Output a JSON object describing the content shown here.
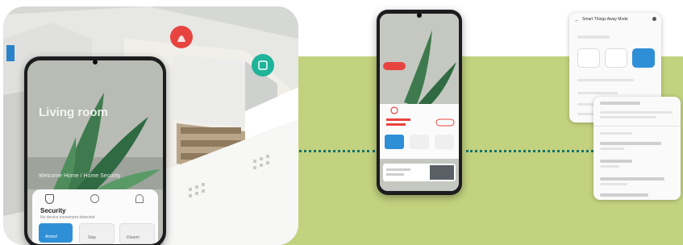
{
  "app": {
    "mode_label": "Smart Things Away Mode"
  },
  "main_phone": {
    "room_title": "Living room",
    "scene_caption": "Welcome Home / Home Security",
    "card_title": "Security",
    "card_subtitle": "No device movement detected",
    "buttons": [
      "Armed",
      "Stay",
      "Disarm"
    ]
  },
  "colors": {
    "green_band": "#c3d27f",
    "connector": "#16736a",
    "pin_alert": "#e8443f",
    "pin_ok": "#1fb39a",
    "accent": "#2f8fd6"
  },
  "icons": [
    "fire-alert-pin",
    "shield-ok-pin",
    "shield-icon",
    "gear-icon",
    "bell-icon",
    "more-icon"
  ]
}
